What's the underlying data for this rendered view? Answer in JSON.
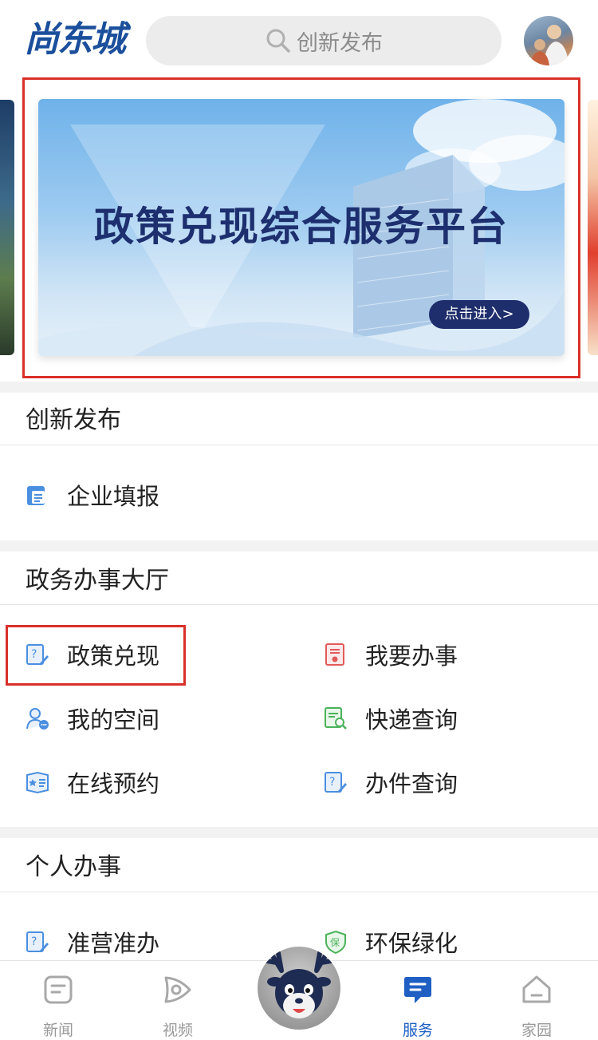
{
  "header": {
    "logo_text": "尚东城",
    "search_placeholder": "创新发布",
    "search_icon": "search-icon",
    "avatar_icon": "user-avatar"
  },
  "banner": {
    "title": "政策兑现综合服务平台",
    "button_label": "点击进入>"
  },
  "sections": {
    "innovation": {
      "title": "创新发布",
      "items": [
        {
          "label": "企业填报",
          "icon": "enterprise-report-icon"
        }
      ]
    },
    "gov_hall": {
      "title": "政务办事大厅",
      "items": [
        {
          "label": "政策兑现",
          "icon": "policy-question-icon"
        },
        {
          "label": "我要办事",
          "icon": "document-seal-icon"
        },
        {
          "label": "我的空间",
          "icon": "user-chat-icon"
        },
        {
          "label": "快递查询",
          "icon": "document-search-icon"
        },
        {
          "label": "在线预约",
          "icon": "ticket-star-icon"
        },
        {
          "label": "办件查询",
          "icon": "question-edit-icon"
        }
      ]
    },
    "personal": {
      "title": "个人办事",
      "items": [
        {
          "label": "准营准办",
          "icon": "question-edit-icon"
        },
        {
          "label": "环保绿化",
          "icon": "shield-protect-icon",
          "badge": "保"
        }
      ]
    }
  },
  "tabbar": {
    "tabs": [
      {
        "label": "新闻",
        "icon": "news-icon",
        "active": false
      },
      {
        "label": "视频",
        "icon": "video-play-icon",
        "active": false
      },
      {
        "label": "服务",
        "icon": "service-chat-icon",
        "active": true
      },
      {
        "label": "家园",
        "icon": "home-icon",
        "active": false
      }
    ],
    "center_icon": "deer-mascot-icon"
  },
  "colors": {
    "brand_blue": "#1b4f9c",
    "active_tab": "#1f5fc4",
    "highlight_red": "#d9302a",
    "banner_navy": "#1e2d6b"
  }
}
